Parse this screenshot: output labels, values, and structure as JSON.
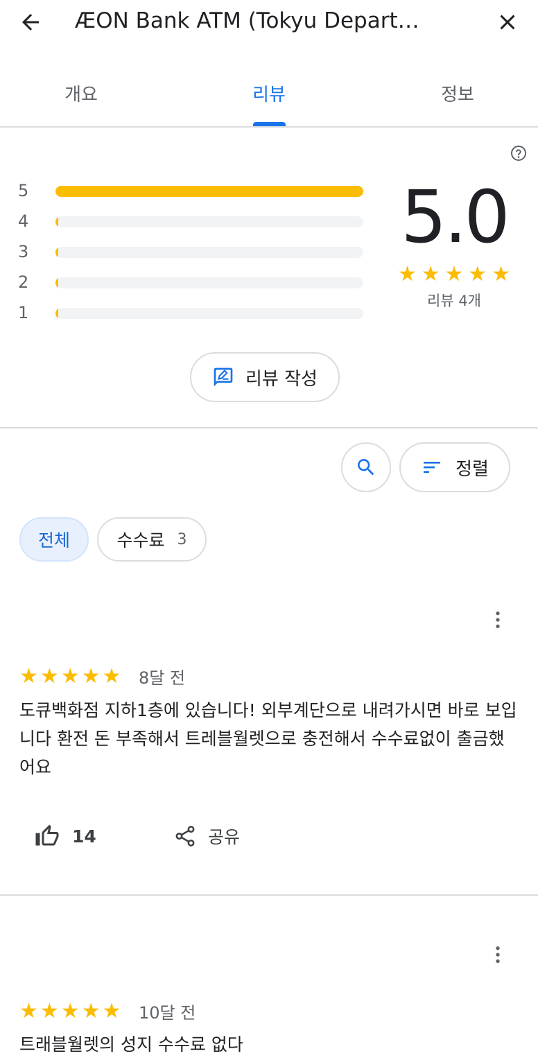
{
  "header": {
    "title": "ÆON Bank ATM (Tokyu Depart…"
  },
  "tabs": [
    {
      "label": "개요"
    },
    {
      "label": "리뷰"
    },
    {
      "label": "정보"
    }
  ],
  "rating": {
    "average": "5.0",
    "stars": 5,
    "review_count_label": "리뷰 4개",
    "histogram": [
      {
        "label": "5",
        "fraction": 1.0
      },
      {
        "label": "4",
        "fraction": 0.0
      },
      {
        "label": "3",
        "fraction": 0.0
      },
      {
        "label": "2",
        "fraction": 0.0
      },
      {
        "label": "1",
        "fraction": 0.0
      }
    ]
  },
  "actions": {
    "write_review_label": "리뷰 작성",
    "sort_label": "정렬"
  },
  "filters": [
    {
      "label": "전체",
      "selected": true
    },
    {
      "label": "수수료",
      "count": "3",
      "selected": false
    }
  ],
  "reviews": [
    {
      "stars": 5,
      "date": "8달 전",
      "text": "도큐백화점 지하1층에 있습니다! 외부계단으로 내려가시면 바로 보입니다 환전 돈 부족해서 트레블월렛으로 충전해서 수수료없이 출금했어요",
      "likes": "14",
      "share_label": "공유"
    },
    {
      "stars": 5,
      "date": "10달 전",
      "text": "트래블월렛의 성지 수수료 없다"
    }
  ],
  "colors": {
    "accent": "#1a73e8",
    "star": "#fbbc04",
    "chip_selected_bg": "#e8f0fe",
    "divider": "#dadce0"
  }
}
